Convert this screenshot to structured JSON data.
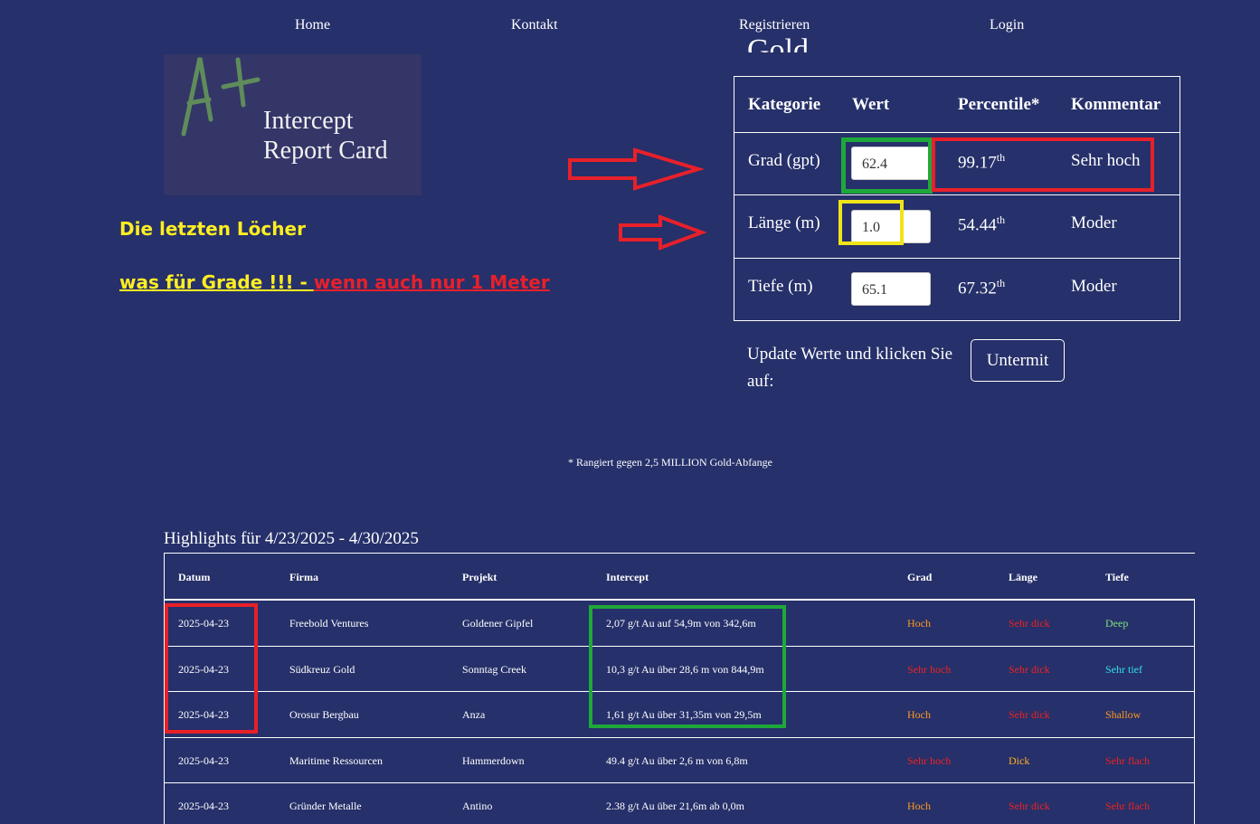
{
  "nav": {
    "home": "Home",
    "contact": "Kontakt",
    "register": "Registrieren",
    "login": "Login"
  },
  "logo": {
    "mark": "A+",
    "line1": "Intercept",
    "line2": "Report Card"
  },
  "promo": {
    "line1": "Die letzten Löcher",
    "line2_yellow": "was für Grade  !!!  - ",
    "line2_red": "wenn auch nur 1 Meter"
  },
  "scorecard": {
    "title": "Gold",
    "headers": [
      "Kategorie",
      "Wert",
      "Percentile*",
      "Kommentar"
    ],
    "rows": [
      {
        "category": "Grad (gpt)",
        "value": "62.4",
        "percentile": "99.17",
        "suffix": "th",
        "comment": "Sehr hoch"
      },
      {
        "category": "Länge (m)",
        "value": "1.0",
        "percentile": "54.44",
        "suffix": "th",
        "comment": "Moder"
      },
      {
        "category": "Tiefe (m)",
        "value": "65.1",
        "percentile": "67.32",
        "suffix": "th",
        "comment": "Moder"
      }
    ],
    "update_label": "Update Werte und klicken Sie auf:",
    "submit_label": "Untermit",
    "footnote": "* Rangiert gegen 2,5 MILLION Gold-Abfange"
  },
  "highlights": {
    "title": "Highlights für 4/23/2025 - 4/30/2025",
    "headers": [
      "Datum",
      "Firma",
      "Projekt",
      "Intercept",
      "Grad",
      "Länge",
      "Tiefe"
    ],
    "rows": [
      [
        "2025-04-23",
        "Freebold Ventures",
        "Goldener Gipfel",
        "2,07 g/t Au auf 54,9m von 342,6m",
        "Hoch",
        "Sehr dick",
        "Deep"
      ],
      [
        "2025-04-23",
        "Südkreuz Gold",
        "Sonntag Creek",
        "10,3 g/t Au über 28,6 m von 844,9m",
        "Sehr hoch",
        "Sehr dick",
        "Sehr tief"
      ],
      [
        "2025-04-23",
        "Orosur Bergbau",
        "Anza",
        "1,61 g/t Au über 31,35m von 29,5m",
        "Hoch",
        "Sehr dick",
        "Shallow"
      ],
      [
        "2025-04-23",
        "Maritime Ressourcen",
        "Hammerdown",
        "49.4 g/t Au über 2,6 m von 6,8m",
        "Sehr hoch",
        "Dick",
        "Sehr flach"
      ],
      [
        "2025-04-23",
        "Gründer Metalle",
        "Antino",
        "2.38 g/t Au über 21,6m ab 0,0m",
        "Hoch",
        "Sehr dick",
        "Sehr flach"
      ]
    ],
    "row_colors": [
      [
        "#ff9a1f",
        "#ee2222",
        "#7fe07f"
      ],
      [
        "#ee2222",
        "#ee2222",
        "#33e0f0"
      ],
      [
        "#ff9a1f",
        "#ee2222",
        "#ff9a1f"
      ],
      [
        "#ee2222",
        "#ffb020",
        "#ee2222"
      ],
      [
        "#ff9a1f",
        "#ee2222",
        "#ee2222"
      ]
    ]
  },
  "colors": {
    "background": "#26306a",
    "annotation_red": "#e8202a",
    "annotation_green": "#1fa83a",
    "annotation_yellow": "#f0e41a"
  }
}
